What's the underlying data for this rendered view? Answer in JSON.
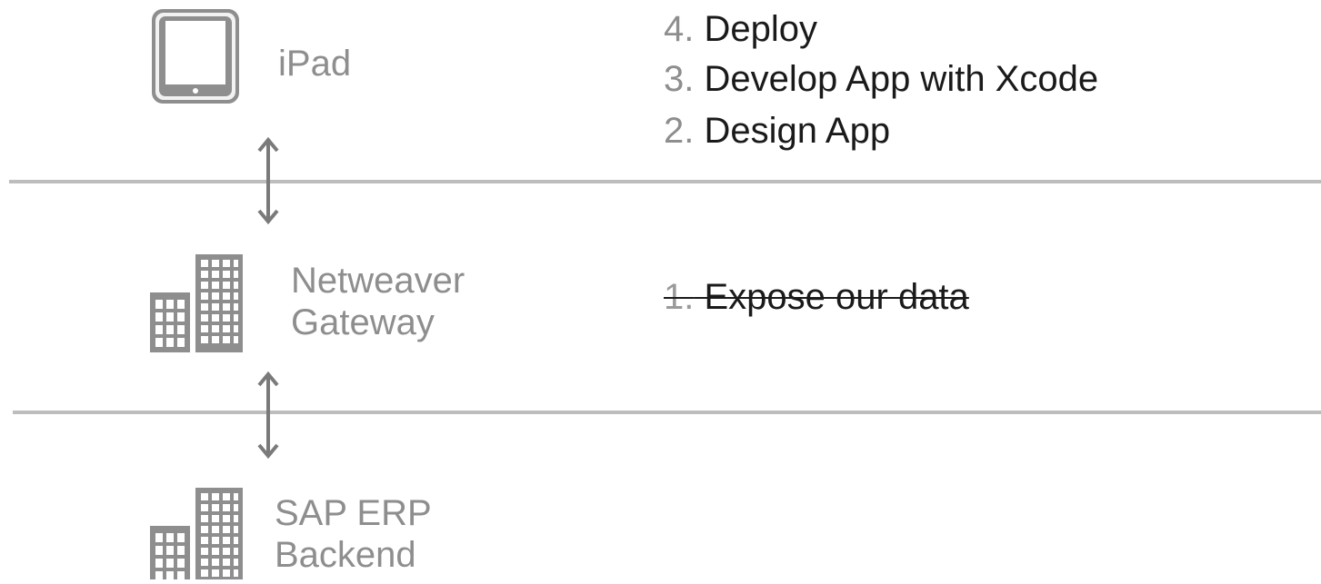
{
  "tiers": [
    {
      "label": "iPad",
      "icon": "ipad-icon"
    },
    {
      "label_line1": "Netweaver",
      "label_line2": "Gateway",
      "icon": "building-icon"
    },
    {
      "label_line1": "SAP ERP",
      "label_line2": "Backend",
      "icon": "building-icon"
    }
  ],
  "steps": [
    {
      "num": "4.",
      "text": "Deploy",
      "done": false
    },
    {
      "num": "3.",
      "text": "Develop App with Xcode",
      "done": false
    },
    {
      "num": "2.",
      "text": "Design App",
      "done": false
    },
    {
      "num": "1.",
      "text": "Expose our data",
      "done": true
    }
  ],
  "colors": {
    "icon": "#8e8e8e",
    "divider": "#bdbdbd",
    "text": "#1a1a1a",
    "muted": "#8e8e8e"
  }
}
